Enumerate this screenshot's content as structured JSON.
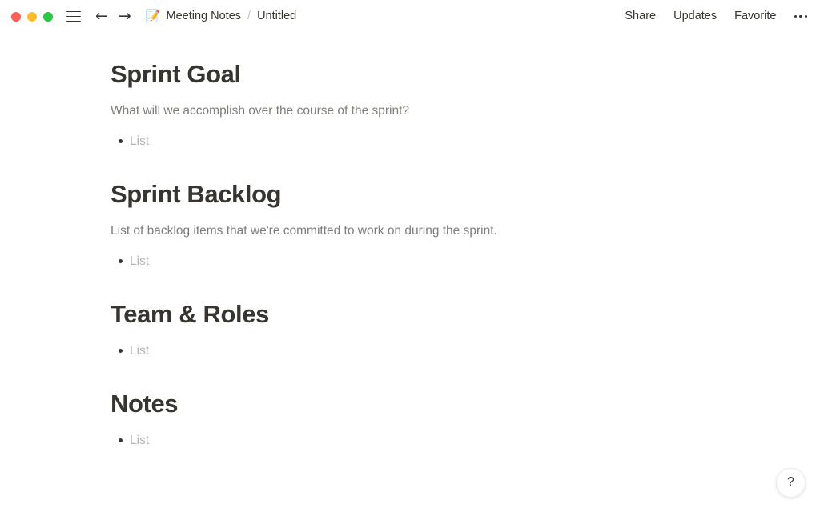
{
  "window": {
    "traffic_lights": [
      {
        "name": "close",
        "color": "#ff5f57"
      },
      {
        "name": "minimize",
        "color": "#febc2e"
      },
      {
        "name": "maximize",
        "color": "#28c840"
      }
    ],
    "menu_icon": "hamburger-icon",
    "back_arrow": "←",
    "forward_arrow": "→"
  },
  "breadcrumb": {
    "emoji": "📝",
    "parent": "Meeting Notes",
    "separator": "/",
    "current": "Untitled"
  },
  "actions": {
    "share": "Share",
    "updates": "Updates",
    "favorite": "Favorite",
    "more": "•••"
  },
  "document": {
    "sections": [
      {
        "heading": "Sprint Goal",
        "description": "What will we accomplish over the course of the sprint?",
        "list_placeholder": "List"
      },
      {
        "heading": "Sprint Backlog",
        "description": "List of backlog items that we're committed to work on during the sprint.",
        "list_placeholder": "List"
      },
      {
        "heading": "Team & Roles",
        "description": "",
        "list_placeholder": "List"
      },
      {
        "heading": "Notes",
        "description": "",
        "list_placeholder": "List"
      }
    ]
  },
  "help": {
    "label": "?"
  },
  "colors": {
    "text_primary": "#37352f",
    "text_secondary": "#7f7e7a",
    "text_placeholder": "#b6b5b2",
    "background": "#ffffff",
    "separator": "#c3c2c0"
  }
}
